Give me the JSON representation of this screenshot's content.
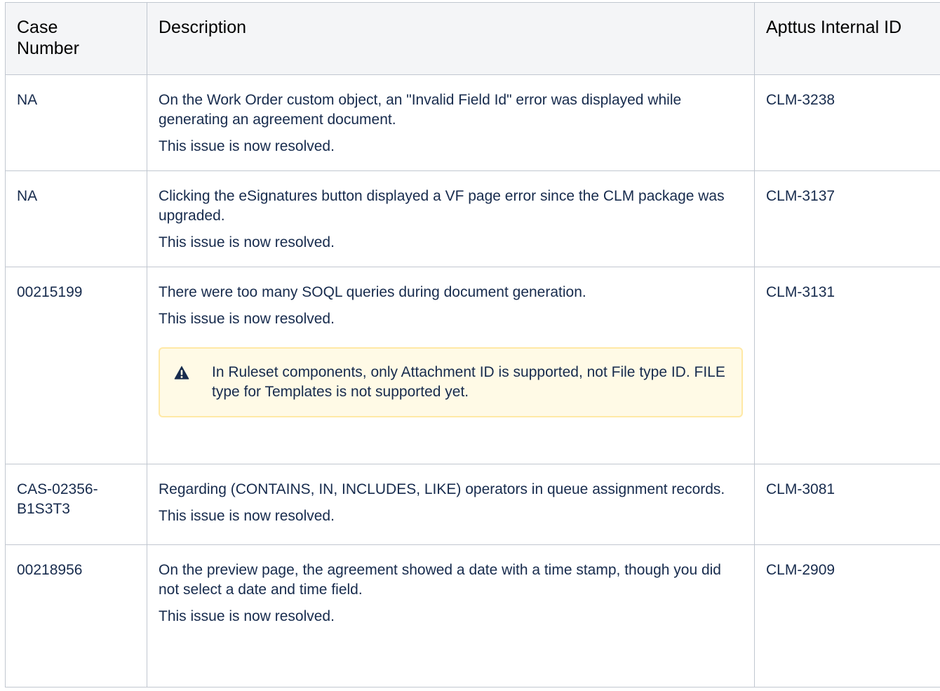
{
  "table": {
    "headers": {
      "case_number": "Case\nNumber",
      "description": "Description",
      "internal_id": "Apttus Internal ID"
    },
    "rows": [
      {
        "case_number": "NA",
        "description": "On the Work Order custom object, an \"Invalid Field Id\" error was displayed while generating an agreement document.",
        "resolution": "This issue is now resolved.",
        "internal_id": "CLM-3238"
      },
      {
        "case_number": "NA",
        "description": "Clicking the eSignatures button displayed a VF page error since the CLM package was upgraded.",
        "resolution": "This issue is now resolved.",
        "internal_id": "CLM-3137"
      },
      {
        "case_number": "00215199",
        "description": "There were too many SOQL queries during document generation.",
        "resolution": "This issue is now resolved.",
        "note": {
          "icon": "warning-icon",
          "text": "In Ruleset components, only Attachment ID is supported, not File type ID. FILE type for Templates is not supported yet."
        },
        "internal_id": "CLM-3131"
      },
      {
        "case_number": "CAS-02356-B1S3T3",
        "description": "Regarding (CONTAINS, IN, INCLUDES, LIKE) operators in queue assignment records.",
        "resolution": "This issue is now resolved.",
        "internal_id": "CLM-3081"
      },
      {
        "case_number": "00218956",
        "description": "On the preview page, the agreement showed a date with a time stamp, though you did not select a date and time field.",
        "resolution": "This issue is now resolved.",
        "internal_id": "CLM-2909"
      }
    ]
  },
  "colors": {
    "header_bg": "#f4f5f7",
    "border": "#c1c7d0",
    "text": "#172b4d",
    "warning_bg": "#fffae6",
    "warning_border": "#ffe9a6",
    "warning_icon": "#172b4d"
  }
}
